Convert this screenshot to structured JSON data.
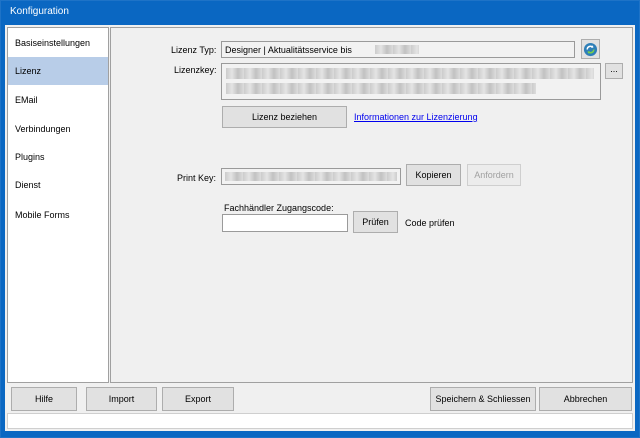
{
  "window": {
    "title": "Konfiguration"
  },
  "sidebar": {
    "items": [
      {
        "label": "Basiseinstellungen",
        "active": false
      },
      {
        "label": "Lizenz",
        "active": true
      },
      {
        "label": "EMail",
        "active": false
      },
      {
        "label": "Verbindungen",
        "active": false
      },
      {
        "label": "Plugins",
        "active": false
      },
      {
        "label": "Dienst",
        "active": false
      },
      {
        "label": "Mobile Forms",
        "active": false
      }
    ]
  },
  "license": {
    "type_label": "Lizenz Typ:",
    "type_value": "Designer | Aktualitätsservice bis",
    "refresh_icon": "refresh-icon",
    "key_label": "Lizenzkey:",
    "browse_label": "...",
    "get_license_label": "Lizenz beziehen",
    "info_link": "Informationen zur Lizenzierung",
    "print_key_label": "Print Key:",
    "copy_label": "Kopieren",
    "request_label": "Anfordern",
    "dealer_code_label": "Fachhändler Zugangscode:",
    "dealer_code_value": "",
    "check_label": "Prüfen",
    "check_hint": "Code prüfen"
  },
  "footer": {
    "help_label": "Hilfe",
    "import_label": "Import",
    "export_label": "Export",
    "save_close_label": "Speichern & Schliessen",
    "cancel_label": "Abbrechen"
  },
  "colors": {
    "titlebar": "#0a67c2",
    "selected_nav": "#b8cde8",
    "link": "#0000ee"
  }
}
